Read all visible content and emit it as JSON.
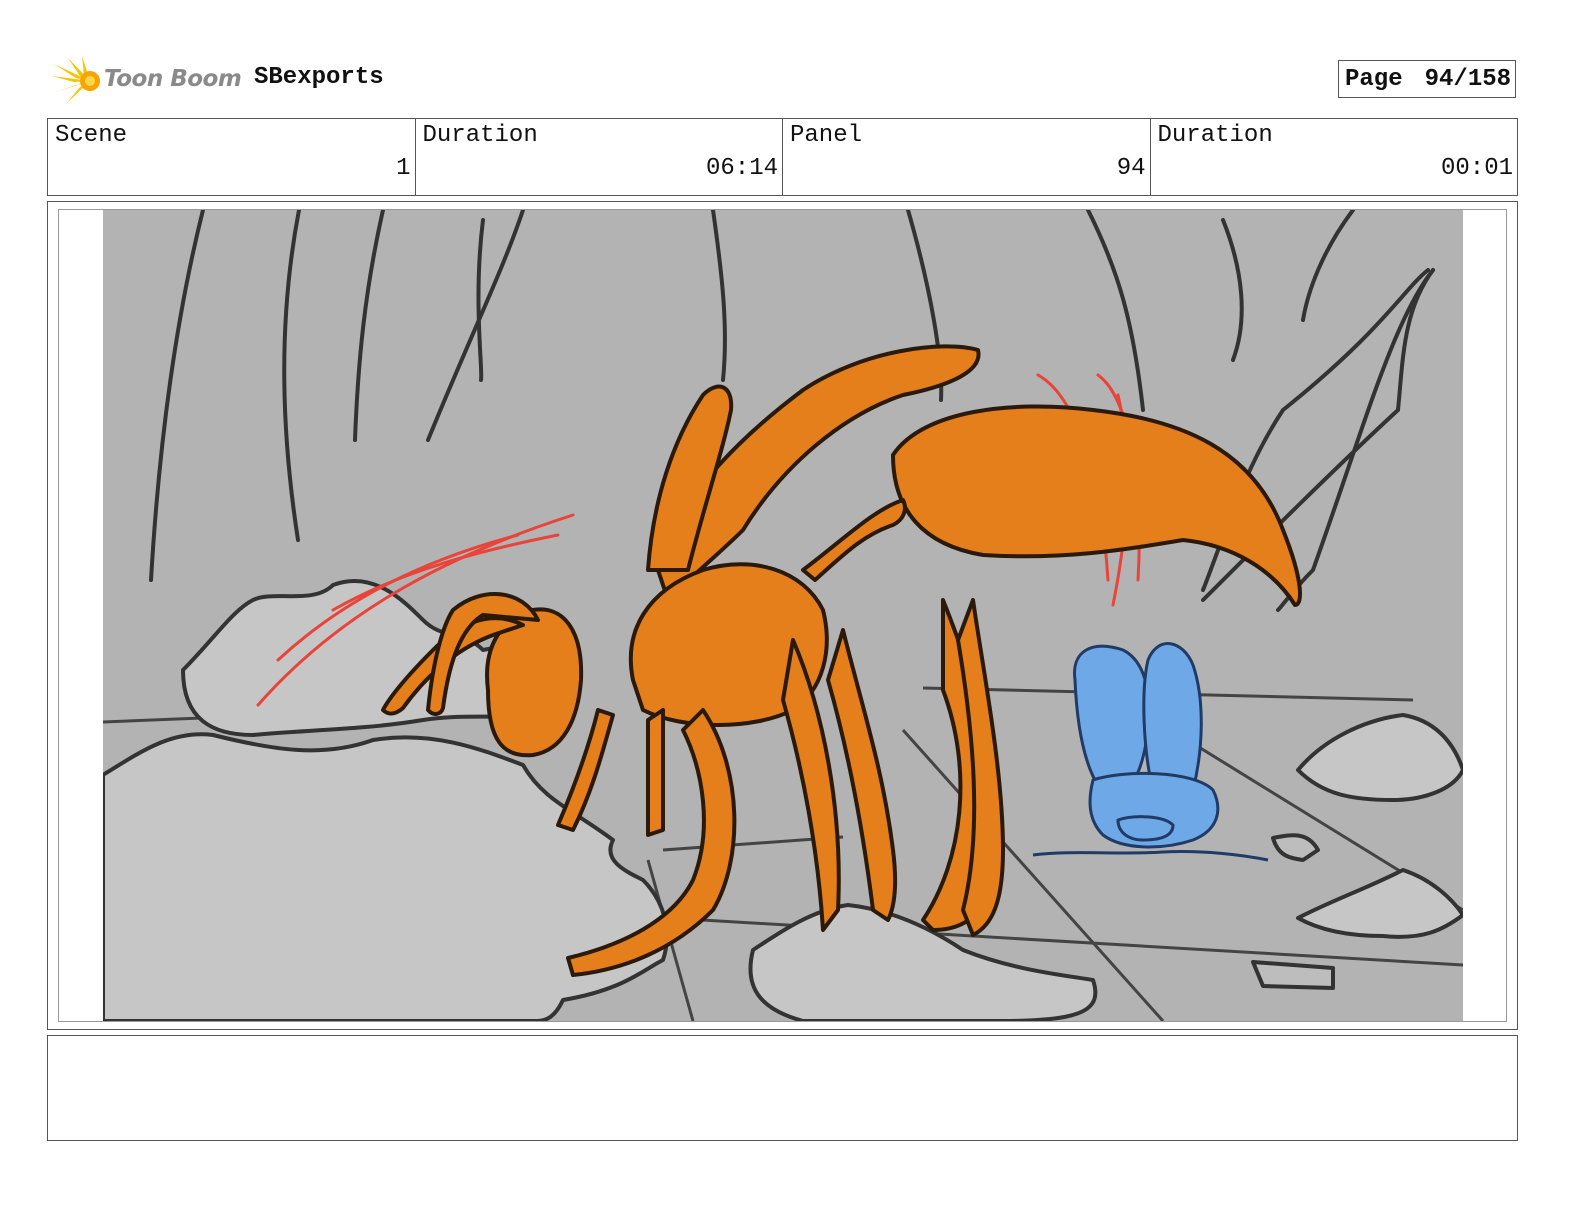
{
  "header": {
    "logo_text": "Toon Boom",
    "project_name": "SBexports",
    "page_label": "Page",
    "page_number": "94/158"
  },
  "info": {
    "scene_label": "Scene",
    "scene_value": "1",
    "scene_duration_label": "Duration",
    "scene_duration_value": "06:14",
    "panel_label": "Panel",
    "panel_value": "94",
    "panel_duration_label": "Duration",
    "panel_duration_value": "00:01"
  },
  "colors": {
    "background_gray": "#b3b3b3",
    "rock_gray": "#c6c6c6",
    "ant_orange": "#e57f1b",
    "bunny_blue": "#6fa8e6",
    "motion_red": "#e8443a",
    "logo_yellow": "#f5c400",
    "logo_text_gray": "#8a8a8a"
  },
  "panel": {
    "icon": "storyboard-sketch",
    "notes": ""
  }
}
